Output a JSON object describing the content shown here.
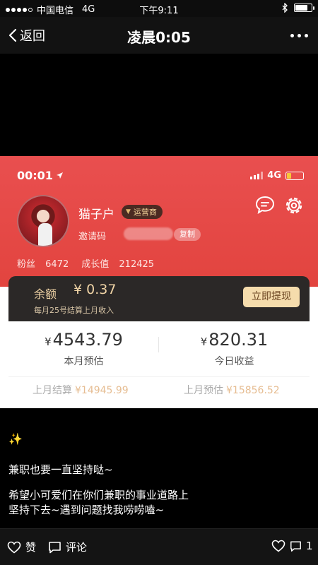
{
  "status_bar": {
    "carrier": "中国电信",
    "network": "4G",
    "time": "下午9:11",
    "battery_level": 0.75
  },
  "nav": {
    "back_label": "返回",
    "title": "凌晨0:05"
  },
  "screenshot": {
    "status_time": "00:01",
    "network": "4G",
    "battery_level": 0.25,
    "profile": {
      "username": "猫子户",
      "role_badge": "运营商",
      "invite_label": "邀请码",
      "copy_label": "复制",
      "fans_label": "粉丝",
      "fans_value": "6472",
      "growth_label": "成长值",
      "growth_value": "212425"
    },
    "balance": {
      "label": "余额",
      "value": "¥ 0.37",
      "note": "每月25号结算上月收入",
      "withdraw_button": "立即提现"
    },
    "earnings": {
      "month_estimate_value": "4543.79",
      "month_estimate_label": "本月预估",
      "today_income_value": "820.31",
      "today_income_label": "今日收益",
      "currency_symbol": "¥",
      "last_month_settled_label": "上月结算",
      "last_month_settled_value": "¥14945.99",
      "last_month_estimate_label": "上月预估",
      "last_month_estimate_value": "¥15856.52"
    }
  },
  "post": {
    "sparkle": "✨",
    "line1": "兼职也要一直坚持哒~",
    "line2": "希望小可爱们在你们兼职的事业道路上",
    "line3": "坚持下去~遇到问题找我唠唠嗑~"
  },
  "bottom_bar": {
    "like_label": "赞",
    "comment_label": "评论",
    "like_count": "1"
  }
}
